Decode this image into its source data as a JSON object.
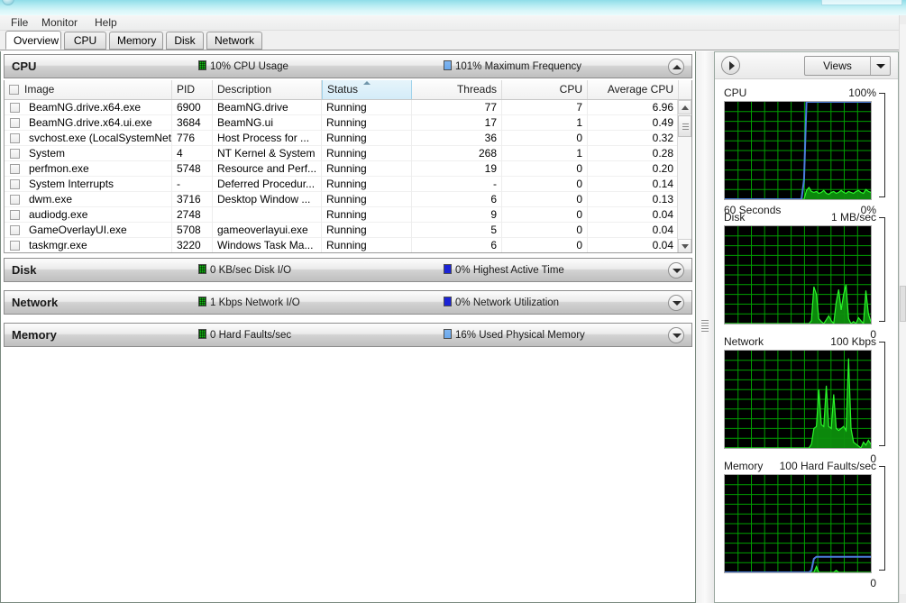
{
  "menu": {
    "items": [
      "File",
      "Monitor",
      "Help"
    ]
  },
  "tabs": [
    {
      "label": "Overview",
      "active": true
    },
    {
      "label": "CPU",
      "active": false
    },
    {
      "label": "Memory",
      "active": false
    },
    {
      "label": "Disk",
      "active": false
    },
    {
      "label": "Network",
      "active": false
    }
  ],
  "sections": {
    "cpu": {
      "title": "CPU",
      "metric1": "10% CPU Usage",
      "metric2": "101% Maximum Frequency",
      "expanded": true,
      "chevron": "chevron-up-icon"
    },
    "disk": {
      "title": "Disk",
      "metric1": "0 KB/sec Disk I/O",
      "metric2": "0% Highest Active Time",
      "expanded": false,
      "chevron": "chevron-down-icon"
    },
    "network": {
      "title": "Network",
      "metric1": "1 Kbps Network I/O",
      "metric2": "0% Network Utilization",
      "expanded": false,
      "chevron": "chevron-down-icon"
    },
    "memory": {
      "title": "Memory",
      "metric1": "0 Hard Faults/sec",
      "metric2": "16% Used Physical Memory",
      "expanded": false,
      "chevron": "chevron-down-icon"
    }
  },
  "table": {
    "columns": [
      "Image",
      "PID",
      "Description",
      "Status",
      "Threads",
      "CPU",
      "Average CPU"
    ],
    "sorted_column": "Status",
    "sort_direction": "ascending",
    "rows": [
      {
        "image": "BeamNG.drive.x64.exe",
        "pid": "6900",
        "description": "BeamNG.drive",
        "status": "Running",
        "threads": "77",
        "cpu": "7",
        "avg_cpu": "6.96"
      },
      {
        "image": "BeamNG.drive.x64.ui.exe",
        "pid": "3684",
        "description": "BeamNG.ui",
        "status": "Running",
        "threads": "17",
        "cpu": "1",
        "avg_cpu": "0.49"
      },
      {
        "image": "svchost.exe (LocalSystemNet...",
        "pid": "776",
        "description": "Host Process for ...",
        "status": "Running",
        "threads": "36",
        "cpu": "0",
        "avg_cpu": "0.32"
      },
      {
        "image": "System",
        "pid": "4",
        "description": "NT Kernel & System",
        "status": "Running",
        "threads": "268",
        "cpu": "1",
        "avg_cpu": "0.28"
      },
      {
        "image": "perfmon.exe",
        "pid": "5748",
        "description": "Resource and Perf...",
        "status": "Running",
        "threads": "19",
        "cpu": "0",
        "avg_cpu": "0.20"
      },
      {
        "image": "System Interrupts",
        "pid": "-",
        "description": "Deferred Procedur...",
        "status": "Running",
        "threads": "-",
        "cpu": "0",
        "avg_cpu": "0.14"
      },
      {
        "image": "dwm.exe",
        "pid": "3716",
        "description": "Desktop Window ...",
        "status": "Running",
        "threads": "6",
        "cpu": "0",
        "avg_cpu": "0.13"
      },
      {
        "image": "audiodg.exe",
        "pid": "2748",
        "description": "",
        "status": "Running",
        "threads": "9",
        "cpu": "0",
        "avg_cpu": "0.04"
      },
      {
        "image": "GameOverlayUI.exe",
        "pid": "5708",
        "description": "gameoverlayui.exe",
        "status": "Running",
        "threads": "5",
        "cpu": "0",
        "avg_cpu": "0.04"
      },
      {
        "image": "taskmgr.exe",
        "pid": "3220",
        "description": "Windows Task Ma...",
        "status": "Running",
        "threads": "6",
        "cpu": "0",
        "avg_cpu": "0.04"
      }
    ]
  },
  "right_panel": {
    "expand_button": "expand-arrow-icon",
    "views_label": "Views",
    "graphs": [
      {
        "title": "CPU",
        "max": "100%",
        "min": "0%",
        "bottom_left": "60 Seconds"
      },
      {
        "title": "Disk",
        "max": "1 MB/sec",
        "min": "0",
        "bottom_left": ""
      },
      {
        "title": "Network",
        "max": "100 Kbps",
        "min": "0",
        "bottom_left": ""
      },
      {
        "title": "Memory",
        "max": "100 Hard Faults/sec",
        "min": "0",
        "bottom_left": ""
      }
    ]
  },
  "colors": {
    "green": "#13c113",
    "blue": "#1b23d6",
    "light_blue": "#6aa8ec",
    "graph_line_blue": "#4a7ddc",
    "graph_grid": "#00a000",
    "graph_bg": "#000000"
  },
  "chart_data": [
    {
      "type": "area",
      "title": "CPU",
      "ylabel": "",
      "xlabel": "60 Seconds",
      "ylim": [
        0,
        100
      ],
      "grid": true,
      "series": [
        {
          "name": "Maximum Frequency",
          "color": "#4a7ddc",
          "values": [
            0,
            0,
            0,
            0,
            0,
            0,
            0,
            0,
            0,
            0,
            0,
            0,
            0,
            0,
            0,
            0,
            0,
            0,
            0,
            0,
            0,
            0,
            0,
            0,
            0,
            0,
            0,
            0,
            0,
            0,
            0,
            0,
            20,
            100,
            100,
            100,
            100,
            100,
            100,
            100,
            100,
            100,
            100,
            100,
            100,
            100,
            100,
            100,
            100,
            100,
            100,
            100,
            100,
            100,
            100,
            100,
            100,
            100,
            100,
            100
          ]
        },
        {
          "name": "CPU Usage",
          "color": "#13c113",
          "values": [
            0,
            0,
            0,
            0,
            0,
            0,
            0,
            0,
            0,
            0,
            0,
            0,
            0,
            0,
            0,
            0,
            0,
            0,
            0,
            0,
            0,
            0,
            0,
            0,
            0,
            0,
            0,
            0,
            0,
            0,
            0,
            0,
            0,
            9,
            12,
            8,
            7,
            8,
            6,
            7,
            9,
            6,
            5,
            7,
            8,
            6,
            7,
            9,
            7,
            6,
            8,
            7,
            6,
            8,
            9,
            7,
            6,
            10,
            8,
            7
          ]
        }
      ]
    },
    {
      "type": "area",
      "title": "Disk",
      "ylabel": "",
      "xlabel": "",
      "ylim": [
        0,
        100
      ],
      "grid": true,
      "series": [
        {
          "name": "Disk I/O",
          "color": "#13c113",
          "values": [
            0,
            0,
            0,
            0,
            0,
            0,
            0,
            0,
            0,
            0,
            0,
            0,
            0,
            0,
            0,
            0,
            0,
            0,
            0,
            0,
            0,
            0,
            0,
            0,
            0,
            0,
            0,
            0,
            0,
            0,
            0,
            0,
            0,
            0,
            0,
            3,
            38,
            30,
            5,
            2,
            0,
            4,
            8,
            3,
            0,
            22,
            35,
            14,
            30,
            40,
            5,
            0,
            2,
            0,
            6,
            3,
            0,
            34,
            10,
            2
          ]
        }
      ]
    },
    {
      "type": "area",
      "title": "Network",
      "ylabel": "",
      "xlabel": "",
      "ylim": [
        0,
        100
      ],
      "grid": true,
      "series": [
        {
          "name": "Network I/O",
          "color": "#13c113",
          "values": [
            0,
            0,
            0,
            0,
            0,
            0,
            0,
            0,
            0,
            0,
            0,
            0,
            0,
            0,
            0,
            0,
            0,
            0,
            0,
            0,
            0,
            0,
            0,
            0,
            0,
            0,
            0,
            0,
            0,
            0,
            0,
            0,
            0,
            0,
            0,
            4,
            20,
            22,
            60,
            24,
            22,
            64,
            22,
            20,
            55,
            20,
            18,
            20,
            22,
            18,
            92,
            20,
            6,
            4,
            2,
            0,
            6,
            3,
            8,
            4
          ]
        }
      ]
    },
    {
      "type": "area",
      "title": "Memory",
      "ylabel": "",
      "xlabel": "",
      "ylim": [
        0,
        100
      ],
      "grid": true,
      "series": [
        {
          "name": "Used Physical Memory",
          "color": "#4a7ddc",
          "values": [
            0,
            0,
            0,
            0,
            0,
            0,
            0,
            0,
            0,
            0,
            0,
            0,
            0,
            0,
            0,
            0,
            0,
            0,
            0,
            0,
            0,
            0,
            0,
            0,
            0,
            0,
            0,
            0,
            0,
            0,
            0,
            0,
            0,
            0,
            0,
            2,
            14,
            16,
            16,
            16,
            16,
            16,
            16,
            16,
            16,
            16,
            16,
            16,
            16,
            16,
            16,
            16,
            16,
            16,
            16,
            16,
            16,
            16,
            16,
            16
          ]
        },
        {
          "name": "Hard Faults/sec",
          "color": "#13c113",
          "values": [
            0,
            0,
            0,
            0,
            0,
            0,
            0,
            0,
            0,
            0,
            0,
            0,
            0,
            0,
            0,
            0,
            0,
            0,
            0,
            0,
            0,
            0,
            0,
            0,
            0,
            0,
            0,
            0,
            0,
            0,
            0,
            0,
            0,
            0,
            0,
            0,
            0,
            6,
            0,
            0,
            0,
            0,
            0,
            0,
            0,
            2,
            0,
            0,
            0,
            0,
            0,
            0,
            0,
            0,
            0,
            0,
            0,
            0,
            0,
            0
          ]
        }
      ]
    }
  ]
}
